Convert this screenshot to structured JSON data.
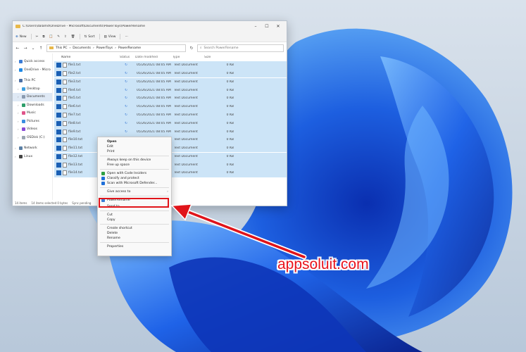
{
  "window": {
    "title": "C:\\Users\\dalamd\\OneDrive - Microsoft\\Documents\\PowerToys\\PowerRename",
    "controls": {
      "minimize": "–",
      "maximize": "☐",
      "close": "✕"
    }
  },
  "toolbar": {
    "new": "New",
    "sort": "Sort",
    "view": "View",
    "more": "···"
  },
  "address": {
    "crumbs": [
      "This PC",
      "Documents",
      "PowerToys",
      "PowerRename"
    ],
    "search_placeholder": "Search PowerRename"
  },
  "nav": [
    {
      "label": "Quick access",
      "color": "#3a7bd5",
      "selected": false
    },
    {
      "label": "OneDrive - Micro",
      "color": "#1e88e5",
      "selected": false
    },
    {
      "label": "This PC",
      "color": "#4a6fa5",
      "selected": false
    },
    {
      "label": "Desktop",
      "color": "#3da0e0",
      "selected": false
    },
    {
      "label": "Documents",
      "color": "#8a9bb0",
      "selected": true
    },
    {
      "label": "Downloads",
      "color": "#2e9e6a",
      "selected": false
    },
    {
      "label": "Music",
      "color": "#e0558a",
      "selected": false
    },
    {
      "label": "Pictures",
      "color": "#3a8ee0",
      "selected": false
    },
    {
      "label": "Videos",
      "color": "#8a4ad5",
      "selected": false
    },
    {
      "label": "OSDisk (C:)",
      "color": "#9aa5b1",
      "selected": false
    },
    {
      "label": "Network",
      "color": "#5a7fa5",
      "selected": false
    },
    {
      "label": "Linux",
      "color": "#444444",
      "selected": false
    }
  ],
  "columns": {
    "name": "Name",
    "status": "Status",
    "date": "Date modified",
    "type": "Type",
    "size": "Size"
  },
  "files": [
    {
      "name": "file1.txt",
      "date": "05/26/2021 08:05 AM",
      "type": "Text Document",
      "size": "0 KB"
    },
    {
      "name": "file2.txt",
      "date": "05/26/2021 08:05 AM",
      "type": "Text Document",
      "size": "0 KB"
    },
    {
      "name": "file3.txt",
      "date": "05/26/2021 08:05 AM",
      "type": "Text Document",
      "size": "0 KB"
    },
    {
      "name": "file4.txt",
      "date": "05/26/2021 08:05 AM",
      "type": "Text Document",
      "size": "0 KB"
    },
    {
      "name": "file5.txt",
      "date": "05/26/2021 08:05 AM",
      "type": "Text Document",
      "size": "0 KB"
    },
    {
      "name": "file6.txt",
      "date": "05/26/2021 08:05 AM",
      "type": "Text Document",
      "size": "0 KB"
    },
    {
      "name": "file7.txt",
      "date": "05/26/2021 08:05 AM",
      "type": "Text Document",
      "size": "0 KB"
    },
    {
      "name": "file8.txt",
      "date": "05/26/2021 08:05 AM",
      "type": "Text Document",
      "size": "0 KB"
    },
    {
      "name": "file9.txt",
      "date": "05/26/2021 08:05 AM",
      "type": "Text Document",
      "size": "0 KB"
    },
    {
      "name": "file10.txt",
      "date": "05/26/2021 08:05 AM",
      "type": "Text Document",
      "size": "0 KB"
    },
    {
      "name": "file11.txt",
      "date": "05/26/2021 08:05 AM",
      "type": "Text Document",
      "size": "0 KB"
    },
    {
      "name": "file12.txt",
      "date": "05/26/2021 08:05 AM",
      "type": "Text Document",
      "size": "0 KB"
    },
    {
      "name": "file13.txt",
      "date": "05/26/2021 08:05 AM",
      "type": "Text Document",
      "size": "0 KB"
    },
    {
      "name": "file14.txt",
      "date": "05/26/2021 08:05 AM",
      "type": "Text Document",
      "size": "0 KB"
    }
  ],
  "statusbar": {
    "count": "14 items",
    "selected": "14 items selected  0 bytes",
    "sync": "Sync pending"
  },
  "context_menu": {
    "items": [
      {
        "label": "Open",
        "bold": true,
        "icon": "",
        "sep": false,
        "arrow": false
      },
      {
        "label": "Edit",
        "bold": false,
        "icon": "",
        "sep": false,
        "arrow": false
      },
      {
        "label": "Print",
        "bold": false,
        "icon": "",
        "sep": true,
        "arrow": false
      },
      {
        "label": "Always keep on this device",
        "bold": false,
        "icon": "",
        "sep": false,
        "arrow": false
      },
      {
        "label": "Free up space",
        "bold": false,
        "icon": "",
        "sep": true,
        "arrow": false
      },
      {
        "label": "Open with Code Insiders",
        "bold": false,
        "icon": "#2ea043",
        "sep": false,
        "arrow": false
      },
      {
        "label": "Classify and protect",
        "bold": false,
        "icon": "#1e6fd9",
        "sep": false,
        "arrow": false
      },
      {
        "label": "Scan with Microsoft Defender...",
        "bold": false,
        "icon": "#1e6fd9",
        "sep": true,
        "arrow": false
      },
      {
        "label": "Give access to",
        "bold": false,
        "icon": "",
        "sep": true,
        "arrow": true
      },
      {
        "label": "PowerRename",
        "bold": false,
        "icon": "#3a7bd5",
        "sep": false,
        "arrow": false
      },
      {
        "label": "Send to",
        "bold": false,
        "icon": "",
        "sep": true,
        "arrow": true
      },
      {
        "label": "Cut",
        "bold": false,
        "icon": "",
        "sep": false,
        "arrow": false
      },
      {
        "label": "Copy",
        "bold": false,
        "icon": "",
        "sep": true,
        "arrow": false
      },
      {
        "label": "Create shortcut",
        "bold": false,
        "icon": "",
        "sep": false,
        "arrow": false
      },
      {
        "label": "Delete",
        "bold": false,
        "icon": "",
        "sep": false,
        "arrow": false
      },
      {
        "label": "Rename",
        "bold": false,
        "icon": "",
        "sep": true,
        "arrow": false
      },
      {
        "label": "Properties",
        "bold": false,
        "icon": "",
        "sep": false,
        "arrow": false
      }
    ]
  },
  "watermark": "appsoluit.com",
  "colors": {
    "accent": "#1a5fb4",
    "highlight": "#e0141a",
    "selection": "#cce4f7"
  }
}
